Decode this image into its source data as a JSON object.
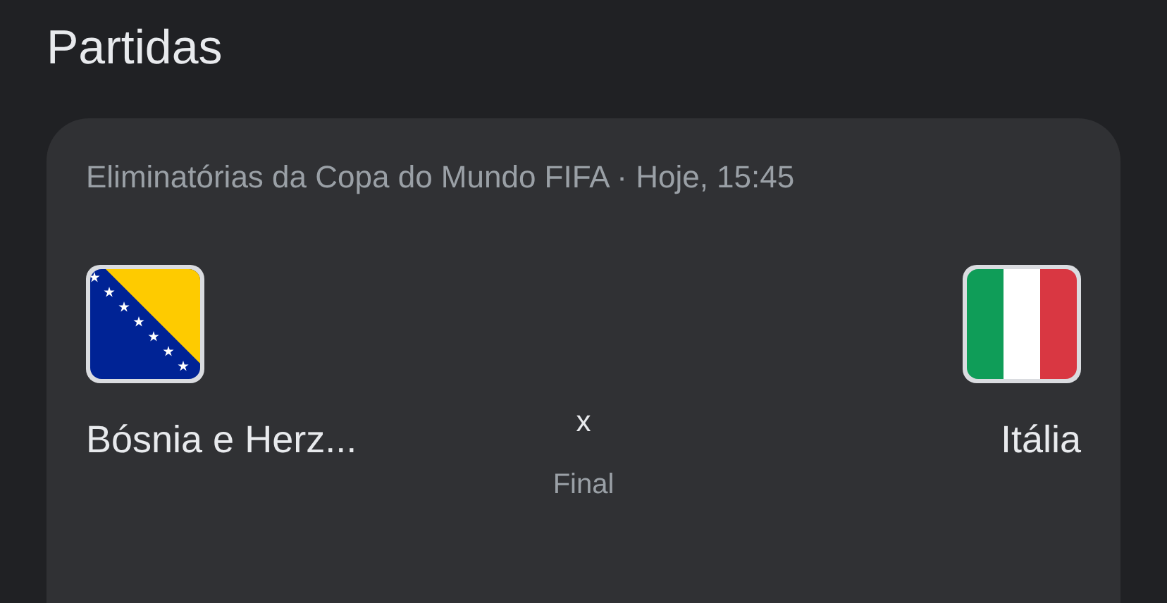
{
  "heading": "Partidas",
  "match": {
    "competition": "Eliminatórias da Copa do Mundo FIFA · Hoje, 15:45",
    "teams": [
      {
        "name": "Bósnia e Herz..."
      },
      {
        "name": "Itália"
      }
    ],
    "separator": "x",
    "status": "Final"
  }
}
